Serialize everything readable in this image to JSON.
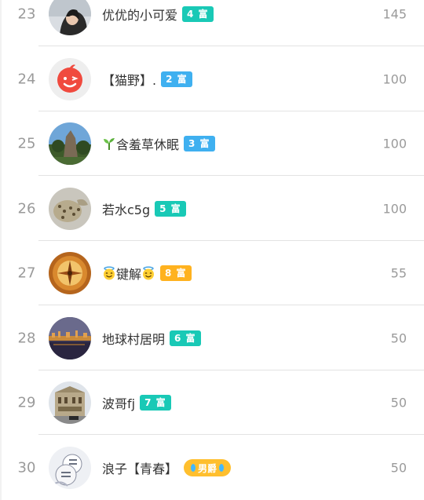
{
  "rows": [
    {
      "rank": "23",
      "name": "优优的小可爱",
      "badge": "4 富",
      "score": "145",
      "avatar": "woman-photo"
    },
    {
      "rank": "24",
      "name": "【猫野】.",
      "badge": "2 富",
      "score": "100",
      "avatar": "red-wink-face"
    },
    {
      "rank": "25",
      "name": "含羞草休眠",
      "badge": "3 富",
      "score": "100",
      "avatar": "landscape-photo"
    },
    {
      "rank": "26",
      "name": "若水c5g",
      "badge": "5 富",
      "score": "100",
      "avatar": "leopard-photo"
    },
    {
      "rank": "27",
      "name": "键解",
      "badge": "8 富",
      "score": "55",
      "avatar": "compass-photo"
    },
    {
      "rank": "28",
      "name": "地球村居明",
      "badge": "6 富",
      "score": "50",
      "avatar": "city-night-photo"
    },
    {
      "rank": "29",
      "name": "波哥fj",
      "badge": "7 富",
      "score": "50",
      "avatar": "building-photo"
    },
    {
      "rank": "30",
      "name": "浪子【青春】",
      "badge": "男爵",
      "score": "50",
      "avatar": "cartoon-photo"
    }
  ],
  "colors": {
    "badge_teal": "#19c9b6",
    "badge_blue": "#3fb0f0",
    "badge_orange": "#ffb21f",
    "badge_gold": "#ffbf2e"
  }
}
